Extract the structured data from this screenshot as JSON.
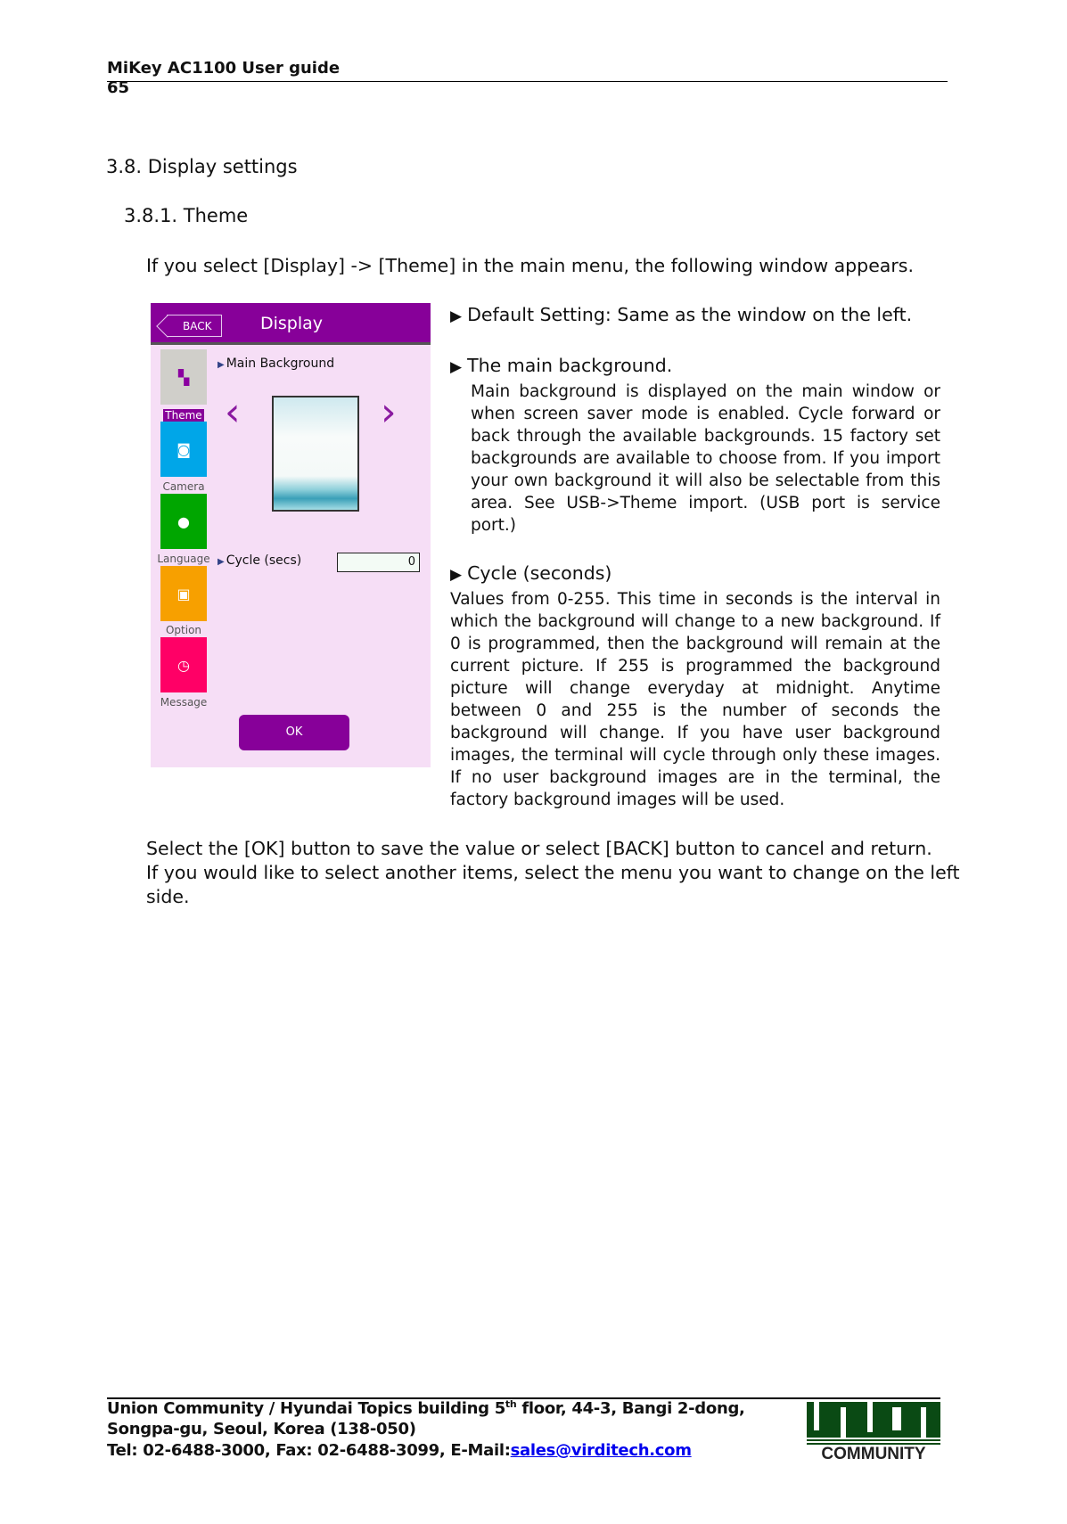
{
  "header": {
    "title": "MiKey AC1100 User guide",
    "page_number": "65"
  },
  "section": {
    "heading": "3.8. Display settings",
    "subheading": "3.8.1. Theme",
    "intro": "If you select [Display] -> [Theme] in the main menu, the following window appears."
  },
  "device": {
    "back_label": "BACK",
    "title": "Display",
    "menu": [
      {
        "label": "Theme",
        "color": "#d0cfca",
        "icon": "theme-icon"
      },
      {
        "label": "Camera",
        "color": "#00a6e8",
        "icon": "camera-icon"
      },
      {
        "label": "Language",
        "color": "#00a600",
        "icon": "language-icon"
      },
      {
        "label": "Option",
        "color": "#f7a000",
        "icon": "monitor-icon"
      },
      {
        "label": "Message",
        "color": "#ff0066",
        "icon": "clock-icon"
      }
    ],
    "main_background_label": "Main Background",
    "cycle_label": "Cycle (secs)",
    "cycle_value": "0",
    "ok_label": "OK",
    "accent": "#870099"
  },
  "description": {
    "default": "Default Setting: Same as the window on the left.",
    "main_bg_title": "The main background.",
    "main_bg_text": "Main background is displayed on the main window or when screen saver mode is enabled. Cycle forward or back through the available backgrounds. 15 factory set backgrounds are available to choose from. If you import your own background it will also be selectable from this area. See USB->Theme import. (USB port is service port.)",
    "cycle_title": "Cycle (seconds)",
    "cycle_text": "Values from 0-255. This time in seconds is the interval in which the background will change to a new background. If 0 is programmed, then the background will remain at the current picture. If 255 is programmed the background picture will change everyday at midnight. Anytime between 0 and 255 is the number of seconds the background will change. If you have user background images, the terminal will cycle through only these images. If no user background images are in the terminal, the factory background images will be used."
  },
  "closing": [
    "Select the [OK] button to save the value or select [BACK] button to cancel and return.",
    "If you would like to select another items, select the menu you want to change on the left side."
  ],
  "footer": {
    "line1a": "Union Community / Hyundai Topics building 5",
    "line1sup": "th",
    "line1b": " floor, 44-3, Bangi 2-dong,",
    "line2": "Songpa-gu, Seoul, Korea (138-050)",
    "line3": "Tel: 02-6488-3000, Fax: 02-6488-3099, E-Mail:",
    "email": "sales@virditech.com",
    "logo_text": "UNION COMMUNITY"
  }
}
